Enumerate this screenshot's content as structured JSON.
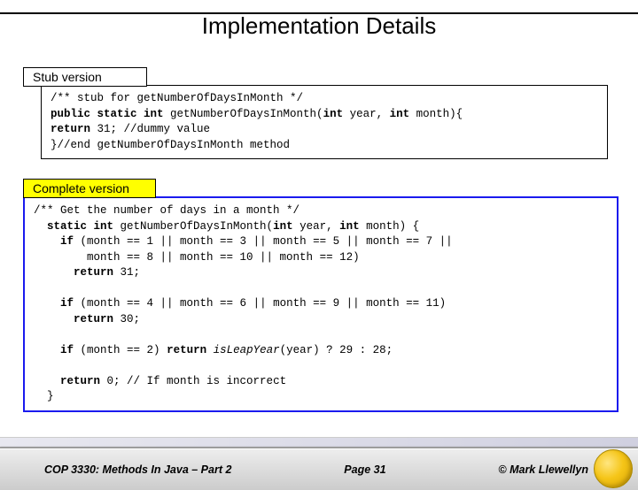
{
  "title": "Implementation Details",
  "stub": {
    "label": "Stub version",
    "line1": "/** stub for getNumberOfDaysInMonth */",
    "line2a": "public static int",
    "line2b": " getNumberOfDaysInMonth(",
    "line2c": "int",
    "line2d": " year, ",
    "line2e": "int",
    "line2f": " month){",
    "line3a": "return",
    "line3b": " 31; //dummy value",
    "line4": "}//end getNumberOfDaysInMonth method"
  },
  "complete": {
    "label": "Complete version",
    "l1": "/** Get the number of days in a month */",
    "l2a": "static int",
    "l2b": " getNumberOfDaysInMonth(",
    "l2c": "int",
    "l2d": " year, ",
    "l2e": "int",
    "l2f": " month) {",
    "l3a": "if",
    "l3b": " (month == 1 || month == 3 || month == 5 || month == 7 ||",
    "l4": "    month == 8 || month == 10 || month == 12)",
    "l5a": "return",
    "l5b": " 31;",
    "l7a": "if",
    "l7b": " (month == 4 || month == 6 || month == 9 || month == 11)",
    "l8a": "return",
    "l8b": " 30;",
    "l10a": "if",
    "l10b": " (month == 2) ",
    "l10c": "return",
    "l10d": " isLeapYear",
    "l10e": "(year) ? 29 : 28;",
    "l12a": "return",
    "l12b": " 0; // If month is incorrect",
    "l13": "}"
  },
  "footer": {
    "left": "COP 3330:  Methods In Java – Part 2",
    "center": "Page 31",
    "right": "© Mark Llewellyn"
  }
}
